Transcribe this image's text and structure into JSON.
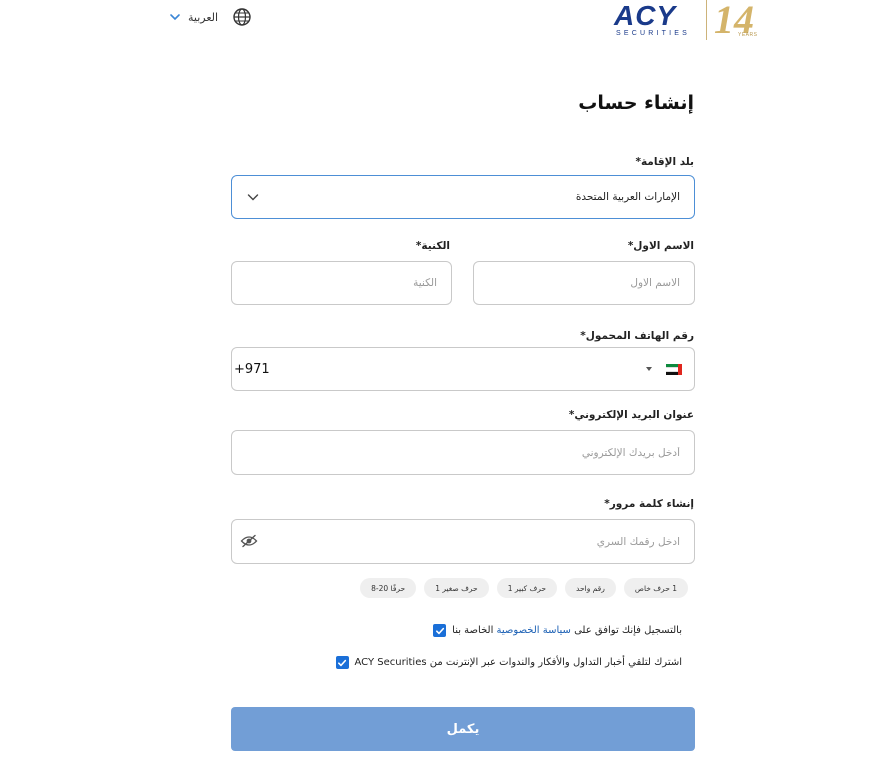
{
  "header": {
    "language_label": "العربية",
    "logo": {
      "brand": "ACY",
      "subbrand": "SECURITIES",
      "anniversary": "14",
      "anniversary_sub": "YEARS"
    }
  },
  "form": {
    "title": "إنشاء حساب",
    "country": {
      "label": "بلد الإقامة*",
      "value": "الإمارات العربية المتحدة"
    },
    "first_name": {
      "label": "الاسم الاول*",
      "placeholder": "الاسم الاول"
    },
    "last_name": {
      "label": "الكنية*",
      "placeholder": "الكنية"
    },
    "phone": {
      "label": "رقم الهاتف المحمول*",
      "code": "+971"
    },
    "email": {
      "label": "عنوان البريد الإلكتروني*",
      "placeholder": "أدخل بريدك الإلكتروني"
    },
    "password": {
      "label": "إنشاء كلمة مرور*",
      "placeholder": "ادخل رقمك السري"
    },
    "rules": [
      "حرفًا 20-8",
      "حرف صغير 1",
      "حرف كبير 1",
      "رقم واحد",
      "1 حرف خاص"
    ],
    "consent_privacy": {
      "before": "بالتسجيل فإنك توافق على",
      "link": "سياسة الخصوصية",
      "after": "الخاصة بنا"
    },
    "consent_news": {
      "text": "اشترك لتلقي أخبار التداول والأفكار والندوات عبر الإنترنت من ACY Securities"
    },
    "submit_label": "يكمل"
  },
  "colors": {
    "accent": "#1a6fd8",
    "submit_bg": "#729ed6",
    "brand": "#1a3a8a",
    "gold": "#d4b46a"
  }
}
